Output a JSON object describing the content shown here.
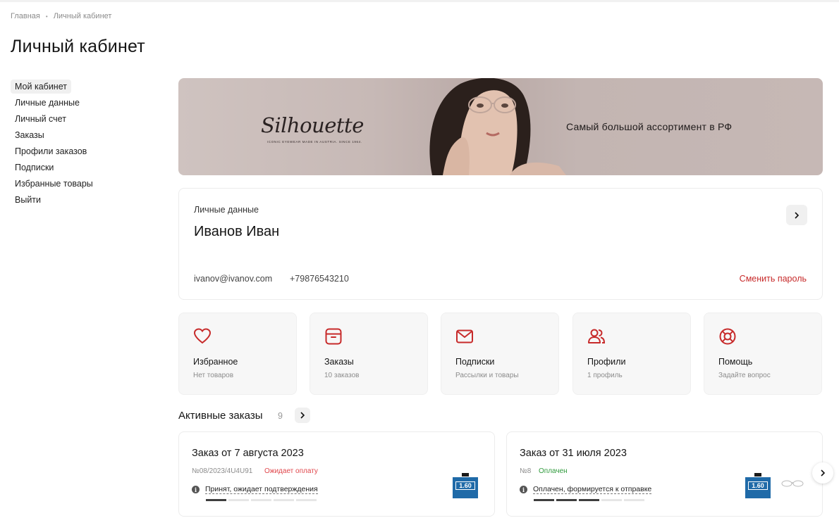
{
  "breadcrumb": {
    "home": "Главная",
    "current": "Личный кабинет"
  },
  "page_title": "Личный кабинет",
  "sidebar": {
    "items": [
      {
        "label": "Мой кабинет",
        "active": true
      },
      {
        "label": "Личные данные"
      },
      {
        "label": "Личный счет"
      },
      {
        "label": "Заказы"
      },
      {
        "label": "Профили заказов"
      },
      {
        "label": "Подписки"
      },
      {
        "label": "Избранные товары"
      },
      {
        "label": "Выйти"
      }
    ]
  },
  "banner": {
    "brand": "Silhouette",
    "brand_sub": "ICONIC EYEWEAR MADE IN AUSTRIA. SINCE 1964.",
    "tagline": "Самый большой ассортимент в РФ"
  },
  "personal": {
    "label": "Личные данные",
    "name": "Иванов Иван",
    "email": "ivanov@ivanov.com",
    "phone": "+79876543210",
    "change_password": "Сменить пароль"
  },
  "tiles": [
    {
      "title": "Избранное",
      "subtitle": "Нет товаров",
      "icon": "heart-icon"
    },
    {
      "title": "Заказы",
      "subtitle": "10 заказов",
      "icon": "box-icon"
    },
    {
      "title": "Подписки",
      "subtitle": "Рассылки и товары",
      "icon": "mail-icon"
    },
    {
      "title": "Профили",
      "subtitle": "1 профиль",
      "icon": "users-icon"
    },
    {
      "title": "Помощь",
      "subtitle": "Задайте вопрос",
      "icon": "lifebuoy-icon"
    }
  ],
  "active_orders": {
    "title": "Активные заказы",
    "count": "9",
    "orders": [
      {
        "title": "Заказ от 7 августа 2023",
        "number": "№08/2023/4U4U91",
        "status": "Ожидает оплату",
        "status_color": "#e0474c",
        "info": "Принят, ожидает подтверждения",
        "progress_done": 1,
        "progress_total": 5,
        "product_label": "1.60"
      },
      {
        "title": "Заказ от 31 июля 2023",
        "number": "№8",
        "status": "Оплачен",
        "status_color": "#2f9a3c",
        "info": "Оплачен, формируется к отправке",
        "progress_done": 3,
        "progress_total": 5,
        "product_label": "1.60"
      }
    ]
  },
  "colors": {
    "accent": "#c72a2a",
    "tile_bg": "#f7f7f7"
  }
}
